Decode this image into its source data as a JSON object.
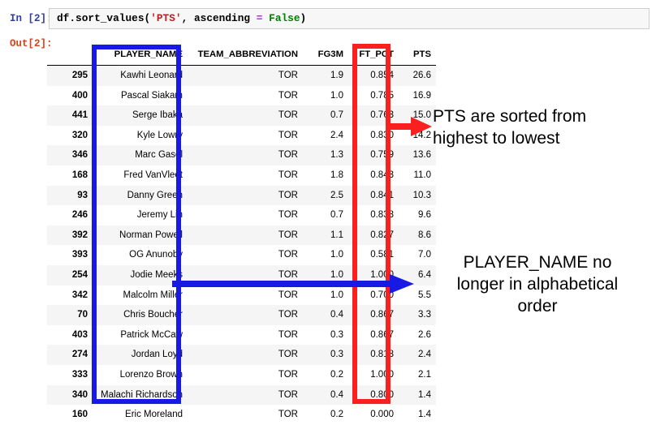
{
  "notebook": {
    "in_prompt": "In [2]:",
    "out_prompt": "Out[2]:",
    "code": {
      "full": "df.sort_values('PTS', ascending = False)",
      "part_1": "df.sort_values(",
      "part_2": "'PTS'",
      "part_3": ", ascending ",
      "part_4": "=",
      "part_5": " ",
      "part_6": "False",
      "part_7": ")"
    }
  },
  "table": {
    "columns": [
      {
        "key": "index",
        "label": ""
      },
      {
        "key": "player_name",
        "label": "PLAYER_NAME"
      },
      {
        "key": "team_abbreviation",
        "label": "TEAM_ABBREVIATION"
      },
      {
        "key": "fg3m",
        "label": "FG3M"
      },
      {
        "key": "ft_pct",
        "label": "FT_PCT"
      },
      {
        "key": "pts",
        "label": "PTS"
      }
    ],
    "rows": [
      {
        "index": "295",
        "player_name": "Kawhi Leonard",
        "team_abbreviation": "TOR",
        "fg3m": "1.9",
        "ft_pct": "0.854",
        "pts": "26.6"
      },
      {
        "index": "400",
        "player_name": "Pascal Siakam",
        "team_abbreviation": "TOR",
        "fg3m": "1.0",
        "ft_pct": "0.785",
        "pts": "16.9"
      },
      {
        "index": "441",
        "player_name": "Serge Ibaka",
        "team_abbreviation": "TOR",
        "fg3m": "0.7",
        "ft_pct": "0.763",
        "pts": "15.0"
      },
      {
        "index": "320",
        "player_name": "Kyle Lowry",
        "team_abbreviation": "TOR",
        "fg3m": "2.4",
        "ft_pct": "0.830",
        "pts": "14.2"
      },
      {
        "index": "346",
        "player_name": "Marc Gasol",
        "team_abbreviation": "TOR",
        "fg3m": "1.3",
        "ft_pct": "0.759",
        "pts": "13.6"
      },
      {
        "index": "168",
        "player_name": "Fred VanVleet",
        "team_abbreviation": "TOR",
        "fg3m": "1.8",
        "ft_pct": "0.843",
        "pts": "11.0"
      },
      {
        "index": "93",
        "player_name": "Danny Green",
        "team_abbreviation": "TOR",
        "fg3m": "2.5",
        "ft_pct": "0.841",
        "pts": "10.3"
      },
      {
        "index": "246",
        "player_name": "Jeremy Lin",
        "team_abbreviation": "TOR",
        "fg3m": "0.7",
        "ft_pct": "0.838",
        "pts": "9.6"
      },
      {
        "index": "392",
        "player_name": "Norman Powell",
        "team_abbreviation": "TOR",
        "fg3m": "1.1",
        "ft_pct": "0.827",
        "pts": "8.6"
      },
      {
        "index": "393",
        "player_name": "OG Anunoby",
        "team_abbreviation": "TOR",
        "fg3m": "1.0",
        "ft_pct": "0.581",
        "pts": "7.0"
      },
      {
        "index": "254",
        "player_name": "Jodie Meeks",
        "team_abbreviation": "TOR",
        "fg3m": "1.0",
        "ft_pct": "1.000",
        "pts": "6.4"
      },
      {
        "index": "342",
        "player_name": "Malcolm Miller",
        "team_abbreviation": "TOR",
        "fg3m": "1.0",
        "ft_pct": "0.700",
        "pts": "5.5"
      },
      {
        "index": "70",
        "player_name": "Chris Boucher",
        "team_abbreviation": "TOR",
        "fg3m": "0.4",
        "ft_pct": "0.867",
        "pts": "3.3"
      },
      {
        "index": "403",
        "player_name": "Patrick McCaw",
        "team_abbreviation": "TOR",
        "fg3m": "0.3",
        "ft_pct": "0.867",
        "pts": "2.6"
      },
      {
        "index": "274",
        "player_name": "Jordan Loyd",
        "team_abbreviation": "TOR",
        "fg3m": "0.3",
        "ft_pct": "0.818",
        "pts": "2.4"
      },
      {
        "index": "333",
        "player_name": "Lorenzo Brown",
        "team_abbreviation": "TOR",
        "fg3m": "0.2",
        "ft_pct": "1.000",
        "pts": "2.1"
      },
      {
        "index": "340",
        "player_name": "Malachi Richardson",
        "team_abbreviation": "TOR",
        "fg3m": "0.4",
        "ft_pct": "0.800",
        "pts": "1.4"
      },
      {
        "index": "160",
        "player_name": "Eric Moreland",
        "team_abbreviation": "TOR",
        "fg3m": "0.2",
        "ft_pct": "0.000",
        "pts": "1.4"
      }
    ]
  },
  "annotations": {
    "pts_note_line1": "PTS are sorted from",
    "pts_note_line2": "highest to lowest",
    "name_note_line1": "PLAYER_NAME no",
    "name_note_line2": "longer in alphabetical",
    "name_note_line3": "order"
  },
  "colors": {
    "highlight_red": "#FA2020",
    "highlight_blue": "#1919E6",
    "in_prompt": "#303F9F",
    "out_prompt": "#D84315",
    "code_string": "#BA2121",
    "code_keyword": "#008000",
    "code_operator": "#AA22FF"
  }
}
